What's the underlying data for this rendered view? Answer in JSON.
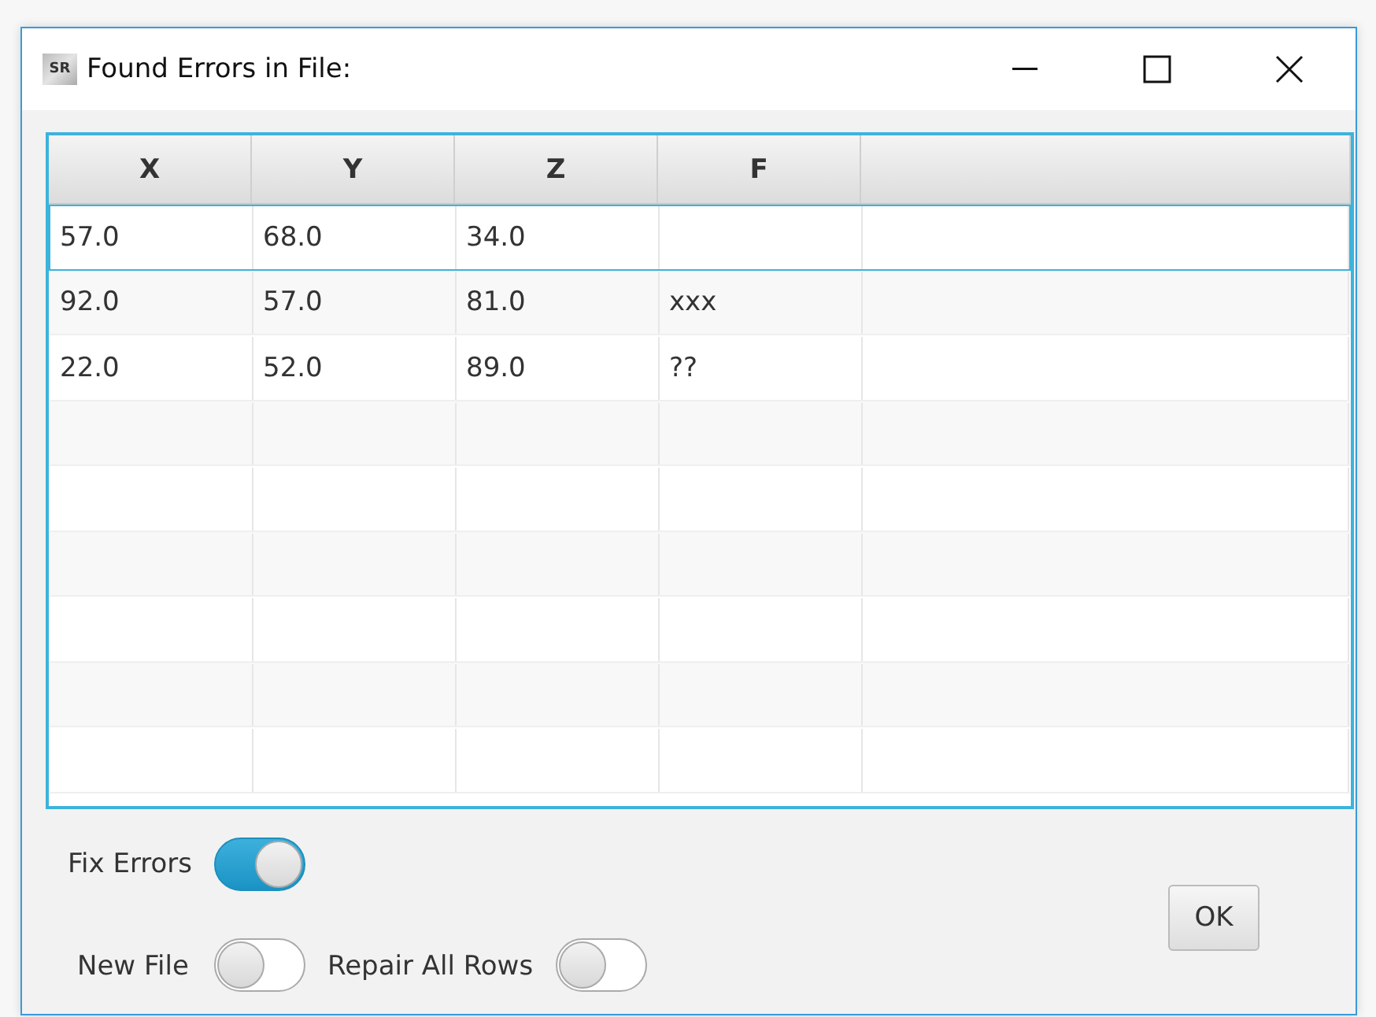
{
  "window": {
    "icon_text": "SR",
    "title": "Found Errors in File:"
  },
  "table": {
    "columns": [
      "X",
      "Y",
      "Z",
      "F"
    ],
    "rows": [
      {
        "cells": [
          "57.0",
          "68.0",
          "34.0",
          ""
        ],
        "selected": true
      },
      {
        "cells": [
          "92.0",
          "57.0",
          "81.0",
          "xxx"
        ],
        "selected": false
      },
      {
        "cells": [
          "22.0",
          "52.0",
          "89.0",
          "??"
        ],
        "selected": false
      }
    ]
  },
  "toggles": [
    {
      "label": "Fix Errors",
      "on": true
    },
    {
      "label": "New File",
      "on": false
    },
    {
      "label": "Repair All Rows",
      "on": false
    }
  ],
  "ok_button": "OK"
}
